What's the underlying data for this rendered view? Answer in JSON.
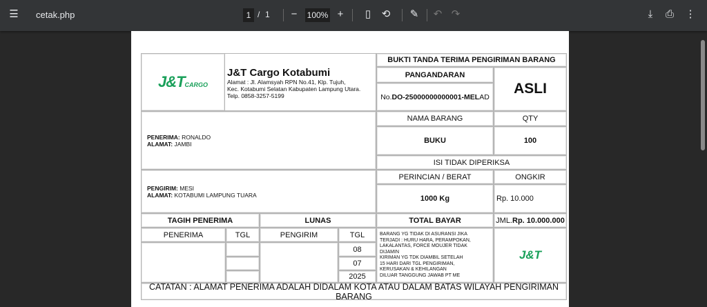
{
  "toolbar": {
    "title": "cetak.php",
    "page_current": "1",
    "page_sep": "/",
    "page_total": "1",
    "zoom": "100%"
  },
  "header": {
    "logo": "J&T",
    "logo_sub": "CARGO",
    "company": "J&T Cargo Kotabumi",
    "address1": "Alamat : Jl. Alamsyah RPN No.41, Klp. Tujuh,",
    "address2": "Kec. Kotabumi Selatan Kabupaten Lampung Utara.",
    "phone": "Telp. 0858-3257-5199"
  },
  "receipt": {
    "title": "BUKTI TANDA TERIMA PENGIRIMAN BARANG",
    "destination": "PANGANDARAN",
    "no_label": "No.",
    "no_value": "DO-25000000000001-MEL",
    "no_suffix": "AD",
    "copy": "ASLI"
  },
  "recipient": {
    "name_label": "PENERIMA:",
    "name": "RONALDO",
    "addr_label": "ALAMAT:",
    "addr": "JAMBI"
  },
  "sender": {
    "name_label": "PENGIRIM:",
    "name": "MESI",
    "addr_label": "ALAMAT:",
    "addr": "KOTABUMI LAMPUNG TUARA"
  },
  "goods": {
    "name_header": "NAMA BARANG",
    "qty_header": "QTY",
    "name": "BUKU",
    "qty": "100",
    "note": "ISI TIDAK DIPERIKSA",
    "detail_header": "PERINCIAN / BERAT",
    "ongkir_header": "ONGKIR",
    "weight": "1000 Kg",
    "ongkir": "Rp. 10.000"
  },
  "payment": {
    "tagih": "TAGIH PENERIMA",
    "lunas": "LUNAS",
    "total_label": "TOTAL BAYAR",
    "jml_label": "JML.",
    "jml_value": "Rp. 10.000.000"
  },
  "sign": {
    "penerima": "PENERIMA",
    "tgl1": "TGL",
    "pengirim": "PENGIRIM",
    "tgl2": "TGL",
    "day": "08",
    "month": "07",
    "year": "2025"
  },
  "disclaimer": [
    "BARANG YG TIDAK DI ASURANSI JIKA",
    "TERJADI : HURU HARA, PERAMPOKAN,",
    "LAKALANTAS, FORCE MOUJER TIDAK",
    "DIJAMIN",
    "KIRIMAN YG TDK DIAMBIL SETELAH",
    "15 HARI DARI TGL PENGIRIMAN,",
    "KERUSAKAN & KEHILANGAN",
    "DILUAR TANGGUNG JAWAB PT ME"
  ],
  "footer_logo": "J&T",
  "catatan": "CATATAN : ALAMAT PENERIMA ADALAH DIDALAM KOTA ATAU DALAM BATAS WILAYAH PENGIRIMAN BARANG"
}
